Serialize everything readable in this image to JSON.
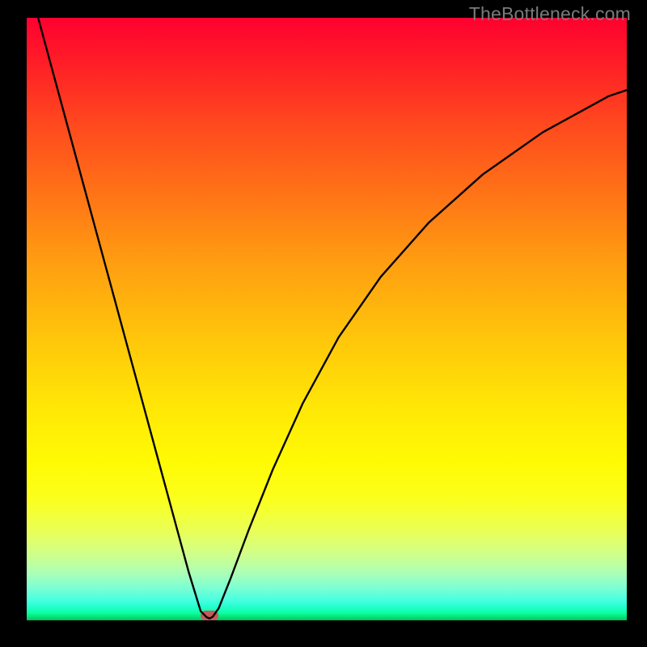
{
  "watermark": "TheBottleneck.com",
  "chart_data": {
    "type": "line",
    "title": "",
    "xlabel": "",
    "ylabel": "",
    "xlim": [
      0,
      100
    ],
    "ylim": [
      0,
      100
    ],
    "background": "red-yellow-green vertical gradient",
    "series": [
      {
        "name": "bottleneck-curve",
        "x": [
          0,
          3,
          6,
          9,
          12,
          15,
          18,
          21,
          24,
          27,
          29,
          30,
          30.5,
          31,
          32,
          34,
          37,
          41,
          46,
          52,
          59,
          67,
          76,
          86,
          97,
          100
        ],
        "y": [
          107,
          96,
          85,
          74,
          63,
          52,
          41,
          30,
          19,
          8,
          1.5,
          0.5,
          0.3,
          0.6,
          2,
          7,
          15,
          25,
          36,
          47,
          57,
          66,
          74,
          81,
          87,
          88
        ]
      }
    ],
    "marker": {
      "x": 30.5,
      "y": 0.8,
      "color": "#c65a5a"
    },
    "grid": false
  }
}
